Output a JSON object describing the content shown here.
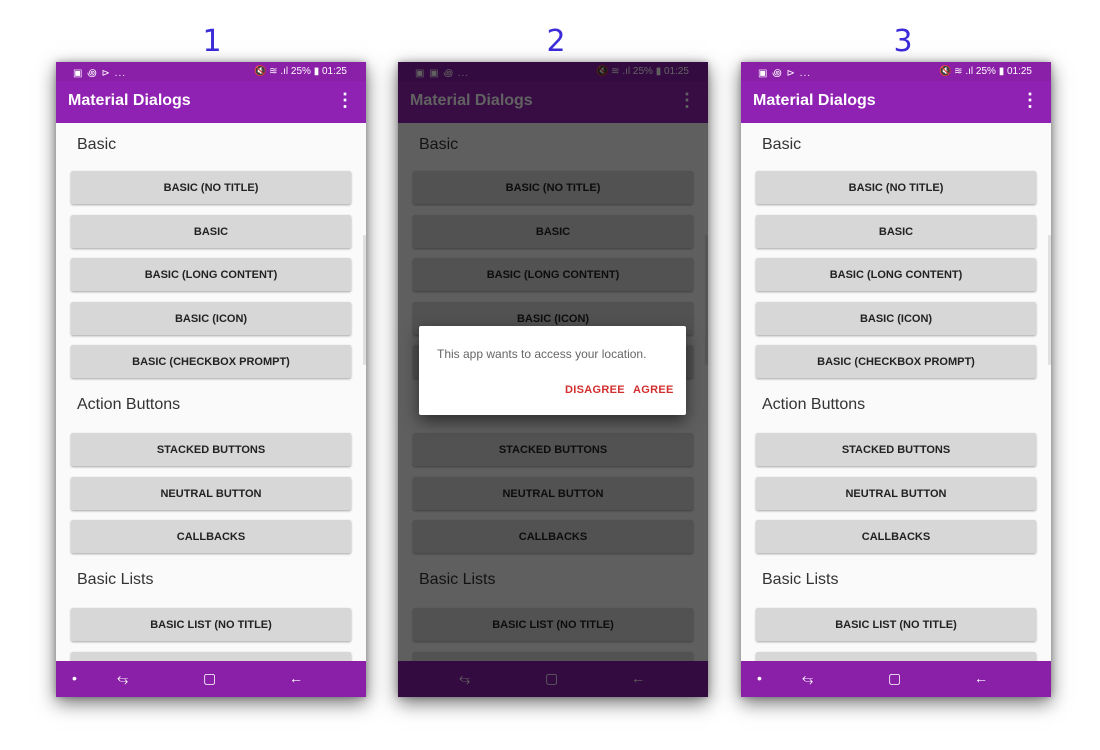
{
  "panel_numbers": [
    "1",
    "2",
    "3"
  ],
  "status_bar": {
    "left_icons": "▣ ꩜ ⊳ ...",
    "left_icons_2": "▣ ▣ ꩜ ...",
    "right": "🔇 ≋ .ıl 25% ▮ 01:25"
  },
  "app_bar": {
    "title": "Material Dialogs",
    "menu_icon": "⋮"
  },
  "sections": {
    "basic": "Basic",
    "action_buttons": "Action Buttons",
    "basic_lists": "Basic Lists"
  },
  "buttons": {
    "basic_no_title": "BASIC (NO TITLE)",
    "basic": "BASIC",
    "basic_long": "BASIC (LONG CONTENT)",
    "basic_icon": "BASIC (ICON)",
    "basic_checkbox": "BASIC (CHECKBOX PROMPT)",
    "stacked": "STACKED BUTTONS",
    "neutral": "NEUTRAL BUTTON",
    "callbacks": "CALLBACKS",
    "basic_list_no_title": "BASIC LIST (NO TITLE)"
  },
  "nav_bar": {
    "dot": "•",
    "recents": "⥃",
    "home": "▢",
    "back": "←"
  },
  "dialog": {
    "message": "This app wants to access your location.",
    "disagree": "DISAGREE",
    "agree": "AGREE"
  },
  "colors": {
    "primary": "#9022b3",
    "status": "#8a1fa8",
    "accent": "#d32f2f",
    "panel_number": "#3b2bd9"
  }
}
